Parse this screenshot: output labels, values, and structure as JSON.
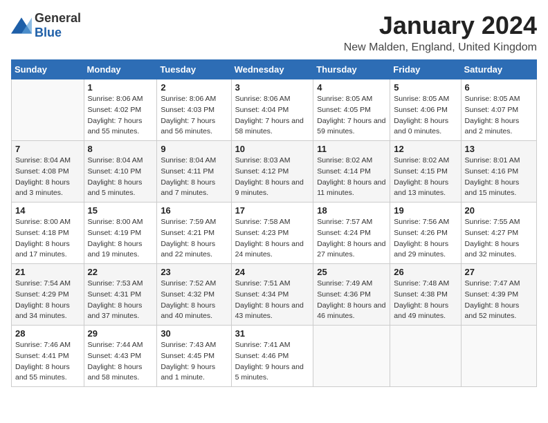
{
  "header": {
    "logo_general": "General",
    "logo_blue": "Blue",
    "title": "January 2024",
    "subtitle": "New Malden, England, United Kingdom"
  },
  "weekdays": [
    "Sunday",
    "Monday",
    "Tuesday",
    "Wednesday",
    "Thursday",
    "Friday",
    "Saturday"
  ],
  "weeks": [
    [
      {
        "day": "",
        "sunrise": "",
        "sunset": "",
        "daylight": ""
      },
      {
        "day": "1",
        "sunrise": "Sunrise: 8:06 AM",
        "sunset": "Sunset: 4:02 PM",
        "daylight": "Daylight: 7 hours and 55 minutes."
      },
      {
        "day": "2",
        "sunrise": "Sunrise: 8:06 AM",
        "sunset": "Sunset: 4:03 PM",
        "daylight": "Daylight: 7 hours and 56 minutes."
      },
      {
        "day": "3",
        "sunrise": "Sunrise: 8:06 AM",
        "sunset": "Sunset: 4:04 PM",
        "daylight": "Daylight: 7 hours and 58 minutes."
      },
      {
        "day": "4",
        "sunrise": "Sunrise: 8:05 AM",
        "sunset": "Sunset: 4:05 PM",
        "daylight": "Daylight: 7 hours and 59 minutes."
      },
      {
        "day": "5",
        "sunrise": "Sunrise: 8:05 AM",
        "sunset": "Sunset: 4:06 PM",
        "daylight": "Daylight: 8 hours and 0 minutes."
      },
      {
        "day": "6",
        "sunrise": "Sunrise: 8:05 AM",
        "sunset": "Sunset: 4:07 PM",
        "daylight": "Daylight: 8 hours and 2 minutes."
      }
    ],
    [
      {
        "day": "7",
        "sunrise": "Sunrise: 8:04 AM",
        "sunset": "Sunset: 4:08 PM",
        "daylight": "Daylight: 8 hours and 3 minutes."
      },
      {
        "day": "8",
        "sunrise": "Sunrise: 8:04 AM",
        "sunset": "Sunset: 4:10 PM",
        "daylight": "Daylight: 8 hours and 5 minutes."
      },
      {
        "day": "9",
        "sunrise": "Sunrise: 8:04 AM",
        "sunset": "Sunset: 4:11 PM",
        "daylight": "Daylight: 8 hours and 7 minutes."
      },
      {
        "day": "10",
        "sunrise": "Sunrise: 8:03 AM",
        "sunset": "Sunset: 4:12 PM",
        "daylight": "Daylight: 8 hours and 9 minutes."
      },
      {
        "day": "11",
        "sunrise": "Sunrise: 8:02 AM",
        "sunset": "Sunset: 4:14 PM",
        "daylight": "Daylight: 8 hours and 11 minutes."
      },
      {
        "day": "12",
        "sunrise": "Sunrise: 8:02 AM",
        "sunset": "Sunset: 4:15 PM",
        "daylight": "Daylight: 8 hours and 13 minutes."
      },
      {
        "day": "13",
        "sunrise": "Sunrise: 8:01 AM",
        "sunset": "Sunset: 4:16 PM",
        "daylight": "Daylight: 8 hours and 15 minutes."
      }
    ],
    [
      {
        "day": "14",
        "sunrise": "Sunrise: 8:00 AM",
        "sunset": "Sunset: 4:18 PM",
        "daylight": "Daylight: 8 hours and 17 minutes."
      },
      {
        "day": "15",
        "sunrise": "Sunrise: 8:00 AM",
        "sunset": "Sunset: 4:19 PM",
        "daylight": "Daylight: 8 hours and 19 minutes."
      },
      {
        "day": "16",
        "sunrise": "Sunrise: 7:59 AM",
        "sunset": "Sunset: 4:21 PM",
        "daylight": "Daylight: 8 hours and 22 minutes."
      },
      {
        "day": "17",
        "sunrise": "Sunrise: 7:58 AM",
        "sunset": "Sunset: 4:23 PM",
        "daylight": "Daylight: 8 hours and 24 minutes."
      },
      {
        "day": "18",
        "sunrise": "Sunrise: 7:57 AM",
        "sunset": "Sunset: 4:24 PM",
        "daylight": "Daylight: 8 hours and 27 minutes."
      },
      {
        "day": "19",
        "sunrise": "Sunrise: 7:56 AM",
        "sunset": "Sunset: 4:26 PM",
        "daylight": "Daylight: 8 hours and 29 minutes."
      },
      {
        "day": "20",
        "sunrise": "Sunrise: 7:55 AM",
        "sunset": "Sunset: 4:27 PM",
        "daylight": "Daylight: 8 hours and 32 minutes."
      }
    ],
    [
      {
        "day": "21",
        "sunrise": "Sunrise: 7:54 AM",
        "sunset": "Sunset: 4:29 PM",
        "daylight": "Daylight: 8 hours and 34 minutes."
      },
      {
        "day": "22",
        "sunrise": "Sunrise: 7:53 AM",
        "sunset": "Sunset: 4:31 PM",
        "daylight": "Daylight: 8 hours and 37 minutes."
      },
      {
        "day": "23",
        "sunrise": "Sunrise: 7:52 AM",
        "sunset": "Sunset: 4:32 PM",
        "daylight": "Daylight: 8 hours and 40 minutes."
      },
      {
        "day": "24",
        "sunrise": "Sunrise: 7:51 AM",
        "sunset": "Sunset: 4:34 PM",
        "daylight": "Daylight: 8 hours and 43 minutes."
      },
      {
        "day": "25",
        "sunrise": "Sunrise: 7:49 AM",
        "sunset": "Sunset: 4:36 PM",
        "daylight": "Daylight: 8 hours and 46 minutes."
      },
      {
        "day": "26",
        "sunrise": "Sunrise: 7:48 AM",
        "sunset": "Sunset: 4:38 PM",
        "daylight": "Daylight: 8 hours and 49 minutes."
      },
      {
        "day": "27",
        "sunrise": "Sunrise: 7:47 AM",
        "sunset": "Sunset: 4:39 PM",
        "daylight": "Daylight: 8 hours and 52 minutes."
      }
    ],
    [
      {
        "day": "28",
        "sunrise": "Sunrise: 7:46 AM",
        "sunset": "Sunset: 4:41 PM",
        "daylight": "Daylight: 8 hours and 55 minutes."
      },
      {
        "day": "29",
        "sunrise": "Sunrise: 7:44 AM",
        "sunset": "Sunset: 4:43 PM",
        "daylight": "Daylight: 8 hours and 58 minutes."
      },
      {
        "day": "30",
        "sunrise": "Sunrise: 7:43 AM",
        "sunset": "Sunset: 4:45 PM",
        "daylight": "Daylight: 9 hours and 1 minute."
      },
      {
        "day": "31",
        "sunrise": "Sunrise: 7:41 AM",
        "sunset": "Sunset: 4:46 PM",
        "daylight": "Daylight: 9 hours and 5 minutes."
      },
      {
        "day": "",
        "sunrise": "",
        "sunset": "",
        "daylight": ""
      },
      {
        "day": "",
        "sunrise": "",
        "sunset": "",
        "daylight": ""
      },
      {
        "day": "",
        "sunrise": "",
        "sunset": "",
        "daylight": ""
      }
    ]
  ]
}
